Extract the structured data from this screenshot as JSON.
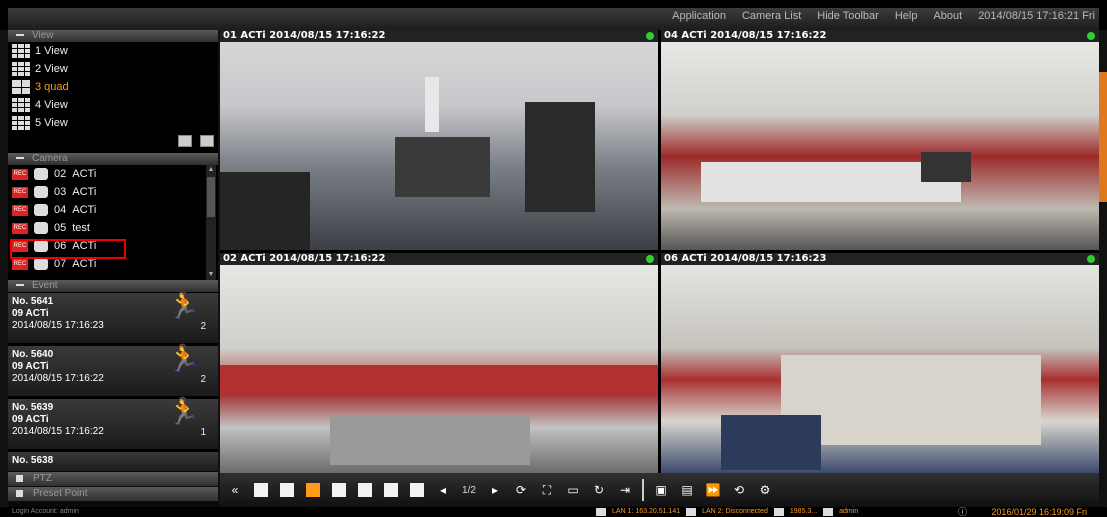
{
  "menu": [
    "Application",
    "Camera List",
    "Hide Toolbar",
    "Help",
    "About"
  ],
  "clock": "2014/08/15 17:16:21 Fri",
  "sections": {
    "view": "View",
    "camera": "Camera",
    "event": "Event",
    "ptz": "PTZ",
    "preset": "Preset Point"
  },
  "views": [
    {
      "label": "1 View",
      "icon": "grid-1-icon",
      "active": false
    },
    {
      "label": "2 View",
      "icon": "grid-2-icon",
      "active": false
    },
    {
      "label": "3 quad",
      "icon": "quad-icon",
      "active": true
    },
    {
      "label": "4 View",
      "icon": "grid-4-icon",
      "active": false
    },
    {
      "label": "5 View",
      "icon": "grid-5-icon",
      "active": false
    }
  ],
  "cameras": [
    {
      "num": "02",
      "name": "ACTi"
    },
    {
      "num": "03",
      "name": "ACTi"
    },
    {
      "num": "04",
      "name": "ACTi"
    },
    {
      "num": "05",
      "name": "test"
    },
    {
      "num": "06",
      "name": "ACTi"
    },
    {
      "num": "07",
      "name": "ACTi"
    }
  ],
  "rec_label": "REC",
  "events": [
    {
      "no": "No. 5641",
      "cam": "09 ACTi",
      "time": "2014/08/15 17:16:23",
      "count": "2"
    },
    {
      "no": "No. 5640",
      "cam": "09 ACTi",
      "time": "2014/08/15 17:16:22",
      "count": "2"
    },
    {
      "no": "No. 5639",
      "cam": "09 ACTi",
      "time": "2014/08/15 17:16:22",
      "count": "1"
    },
    {
      "no": "No. 5638",
      "cam": "",
      "time": "",
      "count": ""
    }
  ],
  "tiles": [
    {
      "title": "01 ACTi  2014/08/15 17:16:22"
    },
    {
      "title": "04 ACTi  2014/08/15 17:16:22"
    },
    {
      "title": "02 ACTi  2014/08/15 17:16:22"
    },
    {
      "title": "06 ACTi  2014/08/15 17:16:23"
    }
  ],
  "toolbar": {
    "page": "1/2"
  },
  "status": {
    "login": "Login Account: admin",
    "lan1": "LAN 1: 163.20.51.141",
    "lan2": "LAN 2: Disconnected",
    "disk": "1985.3...",
    "user": "admin",
    "datetime": "2016/01/29 16:19:09 Fri"
  },
  "colors": {
    "accent": "#ff9a1a",
    "rec": "#dd2222",
    "online": "#33cc33",
    "highlight": "#ee0000"
  }
}
